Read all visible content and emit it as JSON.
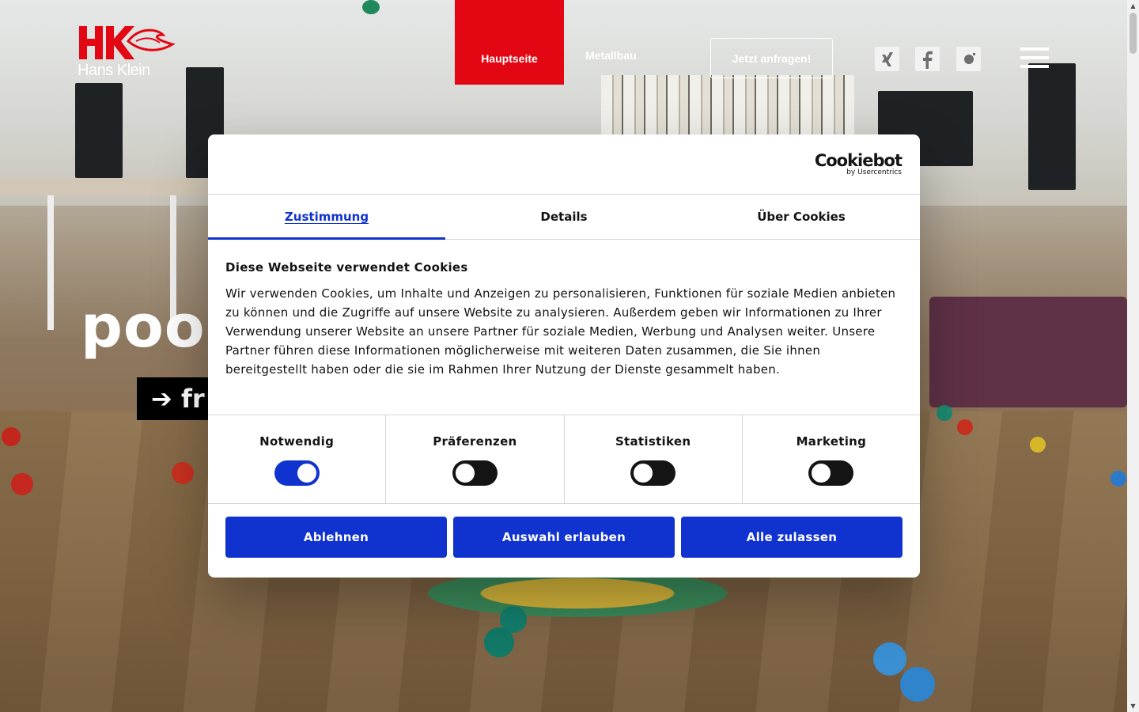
{
  "site": {
    "logo_text": "Hans Klein",
    "brand_color": "#e30613"
  },
  "nav": {
    "home_label": "Hauptseite",
    "metal_label": "Metallbau",
    "cta_label": "Jetzt anfragen!",
    "social_icons": [
      "xing-icon",
      "facebook-icon",
      "instagram-icon"
    ]
  },
  "hero": {
    "title": "pool",
    "cta": "➔ fr"
  },
  "cookie_dialog": {
    "brand": "Cookiebot",
    "brand_sub": "by Usercentrics",
    "tabs": [
      {
        "label": "Zustimmung",
        "active": true
      },
      {
        "label": "Details",
        "active": false
      },
      {
        "label": "Über Cookies",
        "active": false
      }
    ],
    "heading": "Diese Webseite verwendet Cookies",
    "text": "Wir verwenden Cookies, um Inhalte und Anzeigen zu personalisieren, Funktionen für soziale Medien anbieten zu können und die Zugriffe auf unsere Website zu analysieren. Außerdem geben wir Informationen zu Ihrer Verwendung unserer Website an unsere Partner für soziale Medien, Werbung und Analysen weiter. Unsere Partner führen diese Informationen möglicherweise mit weiteren Daten zusammen, die Sie ihnen bereitgestellt haben oder die sie im Rahmen Ihrer Nutzung der Dienste gesammelt haben.",
    "toggles": [
      {
        "label": "Notwendig",
        "on": true
      },
      {
        "label": "Präferenzen",
        "on": false
      },
      {
        "label": "Statistiken",
        "on": false
      },
      {
        "label": "Marketing",
        "on": false
      }
    ],
    "buttons": {
      "decline": "Ablehnen",
      "allow_selection": "Auswahl erlauben",
      "allow_all": "Alle zulassen"
    },
    "accent_color": "#1032cf"
  }
}
